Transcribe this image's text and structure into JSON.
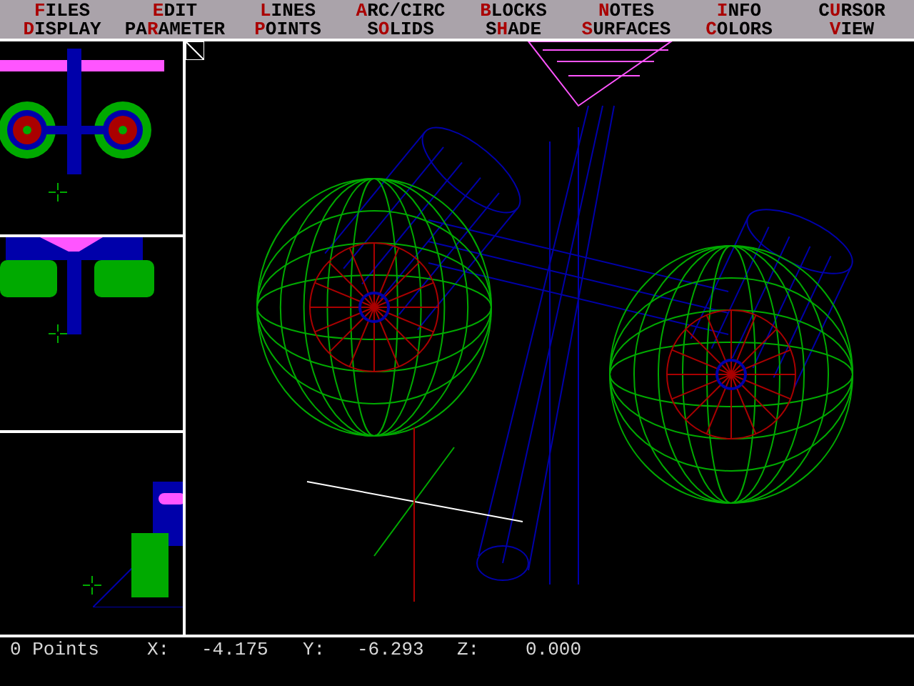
{
  "menu": [
    {
      "key": "F",
      "post": "ILES"
    },
    {
      "key": "E",
      "post": "DIT"
    },
    {
      "key": "L",
      "post": "INES"
    },
    {
      "key": "A",
      "post": "RC/CIRC"
    },
    {
      "key": "B",
      "post": "LOCKS"
    },
    {
      "key": "N",
      "post": "OTES"
    },
    {
      "key": "I",
      "post": "NFO"
    },
    {
      "pre": "C",
      "key": "U",
      "post": "RSOR"
    },
    {
      "key": "D",
      "post": "ISPLAY"
    },
    {
      "pre": "PA",
      "key": "R",
      "post": "AMETER"
    },
    {
      "key": "P",
      "post": "OINTS"
    },
    {
      "pre": "S",
      "key": "O",
      "post": "LIDS"
    },
    {
      "pre": "S",
      "key": "H",
      "post": "ADE"
    },
    {
      "key": "S",
      "post": "URFACES"
    },
    {
      "key": "C",
      "post": "OLORS"
    },
    {
      "key": "V",
      "post": "IEW"
    }
  ],
  "status_bar": {
    "points": "0 Points",
    "x_label": "X:",
    "x_value": "-4.175",
    "y_label": "Y:",
    "y_value": "-6.293",
    "z_label": "Z:",
    "z_value": "0.000"
  }
}
